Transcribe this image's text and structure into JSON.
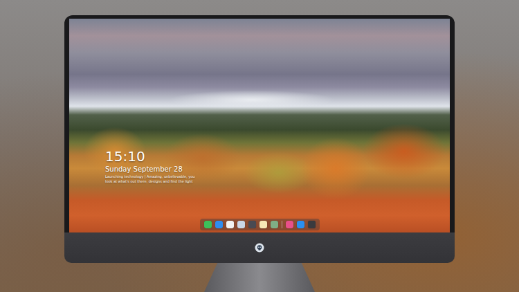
{
  "lock_screen": {
    "time": "15:10",
    "date": "Sunday September 28",
    "caption": [
      "Launching technology | Amazing, unbelievable, you",
      "look at what's out there, designs and find the light"
    ]
  },
  "dock": {
    "items": [
      {
        "kind": "app",
        "color": "#3cc15a"
      },
      {
        "kind": "app",
        "color": "#2f8df0"
      },
      {
        "kind": "app",
        "color": "#f2f2f2"
      },
      {
        "kind": "app",
        "color": "#c9d6e6"
      },
      {
        "kind": "app",
        "color": "#4a4a52"
      },
      {
        "kind": "app",
        "color": "#f6e9b8"
      },
      {
        "kind": "app",
        "color": "#7fae86"
      },
      {
        "kind": "separator",
        "color": "#d8d8d8"
      },
      {
        "kind": "app",
        "color": "#e8508a"
      },
      {
        "kind": "app",
        "color": "#2a8ff0"
      },
      {
        "kind": "app",
        "color": "#3a3a3e"
      }
    ]
  }
}
